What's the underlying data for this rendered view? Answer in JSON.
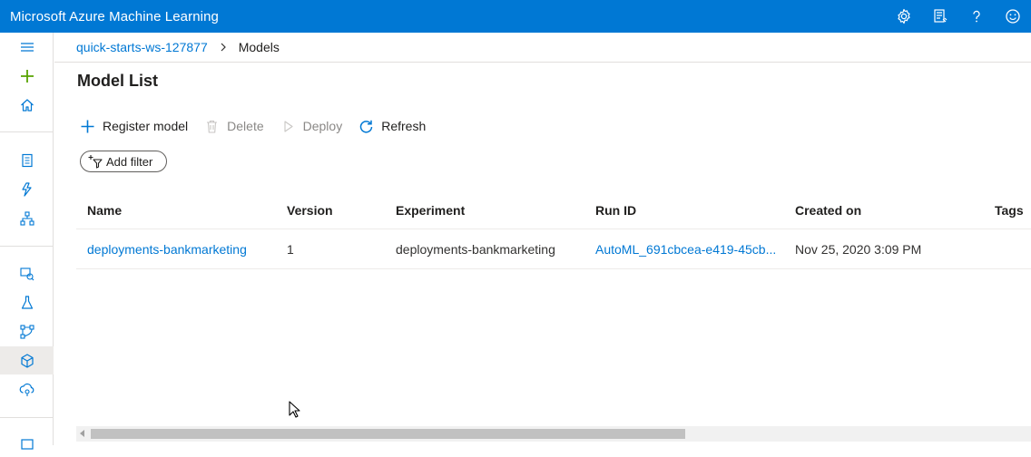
{
  "app": {
    "title": "Microsoft Azure Machine Learning"
  },
  "topbar": {
    "icons": [
      "gear-icon",
      "feedback-list-icon",
      "help-icon",
      "smiley-icon"
    ]
  },
  "leftnav": {
    "items": [
      "hamburger-icon",
      "plus-icon",
      "home-icon",
      "notebook-icon",
      "automl-icon",
      "designer-icon",
      "datasets-icon",
      "experiments-icon",
      "pipelines-icon",
      "models-icon",
      "endpoints-icon",
      "compute-icon"
    ],
    "active": "models-icon",
    "accent_color": "#0078d4",
    "plus_color": "#57a300"
  },
  "breadcrumb": {
    "workspace": "quick-starts-ws-127877",
    "current": "Models"
  },
  "page": {
    "title": "Model List"
  },
  "toolbar": {
    "register_label": "Register model",
    "delete_label": "Delete",
    "deploy_label": "Deploy",
    "refresh_label": "Refresh"
  },
  "filter": {
    "add_label": "Add filter"
  },
  "table": {
    "columns": {
      "name": "Name",
      "version": "Version",
      "experiment": "Experiment",
      "run_id": "Run ID",
      "created_on": "Created on",
      "tags": "Tags"
    },
    "rows": [
      {
        "name": "deployments-bankmarketing",
        "version": "1",
        "experiment": "deployments-bankmarketing",
        "run_id": "AutoML_691cbcea-e419-45cb...",
        "created_on": "Nov 25, 2020 3:09 PM",
        "tags": ""
      }
    ]
  }
}
